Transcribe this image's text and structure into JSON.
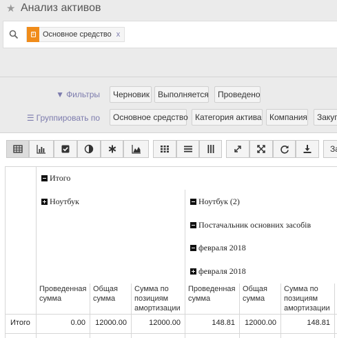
{
  "header": {
    "title": "Анализ активов"
  },
  "search": {
    "facet_value": "Основное средство",
    "facet_close": "x"
  },
  "filters": {
    "label": "Фильтры",
    "options": [
      "Черновик",
      "Выполняется",
      "Проведено"
    ]
  },
  "groupby": {
    "label": "Группировать по",
    "options": [
      "Основное средство",
      "Категория актива",
      "Компания",
      "Закуп"
    ]
  },
  "toolbar": {
    "last_button_label": "За"
  },
  "pivot": {
    "total_header": "Итого",
    "group_left": "Ноутбук",
    "group_right": "Ноутбук (2)",
    "group_right_sub1": "Постачальник основних засобів",
    "group_right_sub2": "февраля 2018",
    "group_right_sub3": "февраля 2018",
    "measures": [
      "Проведенная сумма",
      "Общая сумма",
      "Сумма по позициям амортизации"
    ],
    "row_label": "Итого",
    "values": [
      "0.00",
      "12000.00",
      "12000.00",
      "148.81",
      "12000.00",
      "148.81"
    ]
  },
  "colors": {
    "accent": "#7c7bad",
    "orange": "#f08c1a"
  }
}
